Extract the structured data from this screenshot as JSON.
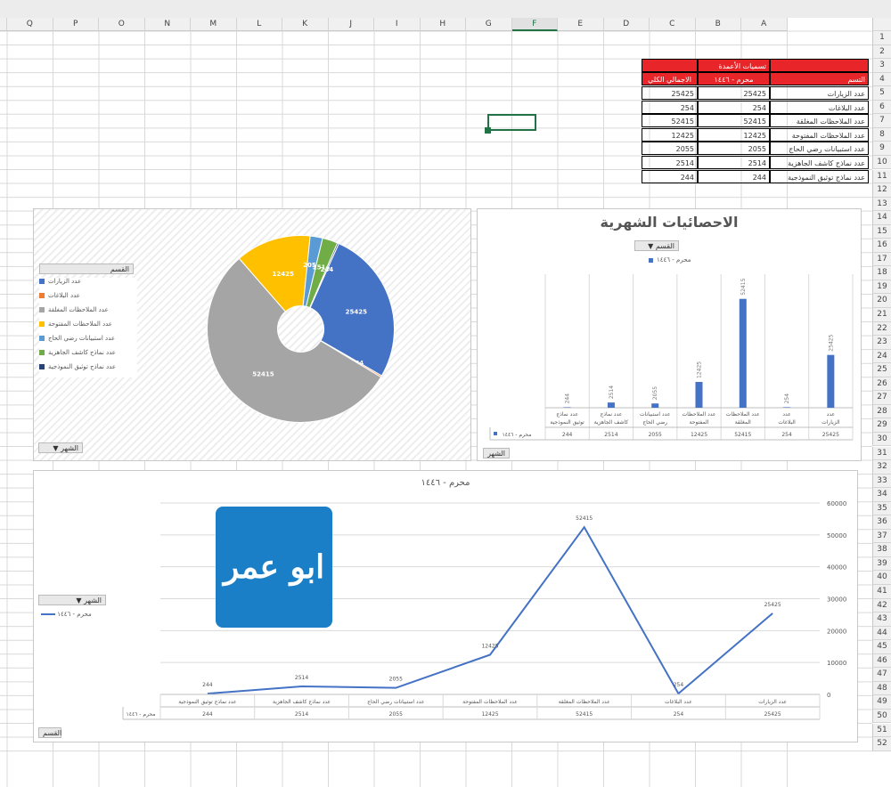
{
  "columns": [
    "Q",
    "P",
    "O",
    "N",
    "M",
    "L",
    "K",
    "J",
    "I",
    "H",
    "G",
    "F",
    "E",
    "D",
    "C",
    "B",
    "A"
  ],
  "active_column": "F",
  "rows": [
    "1",
    "2",
    "3",
    "4",
    "5",
    "6",
    "7",
    "8",
    "9",
    "10",
    "11",
    "12",
    "13",
    "14",
    "15",
    "16",
    "17",
    "18",
    "19",
    "20",
    "21",
    "22",
    "23",
    "24",
    "25",
    "26",
    "27",
    "28",
    "29",
    "30",
    "31",
    "32",
    "33",
    "34",
    "35",
    "36",
    "37",
    "38",
    "39",
    "40",
    "41",
    "42",
    "43",
    "44",
    "45",
    "46",
    "47",
    "48",
    "49",
    "50",
    "51",
    "52"
  ],
  "table": {
    "header_filter": "تسميات الأعمدة",
    "header_label_col": "التسم",
    "header_month": "محرم - ١٤٤٦",
    "header_total": "الاجمالي الكلي",
    "rows": [
      {
        "label": "عدد الزيارات",
        "month": "25425",
        "total": "25425"
      },
      {
        "label": "عدد البلاغات",
        "month": "254",
        "total": "254"
      },
      {
        "label": "عدد الملاحظات المغلقة",
        "month": "52415",
        "total": "52415"
      },
      {
        "label": "عدد الملاحظات المفتوحة",
        "month": "12425",
        "total": "12425"
      },
      {
        "label": "عدد استبيانات رضي الحاج",
        "month": "2055",
        "total": "2055"
      },
      {
        "label": "عدد نماذج كاشف الجاهزية",
        "month": "2514",
        "total": "2514"
      },
      {
        "label": "عدد نماذج توثيق النموذجية",
        "month": "244",
        "total": "244"
      }
    ]
  },
  "pie_panel": {
    "legend_title": "القسم",
    "filter_label": "الشهر",
    "legend": [
      {
        "name": "عدد الزيارات",
        "color": "#4472c4"
      },
      {
        "name": "عدد البلاغات",
        "color": "#ed7d31"
      },
      {
        "name": "عدد الملاحظات المغلقة",
        "color": "#a5a5a5"
      },
      {
        "name": "عدد الملاحظات المفتوحة",
        "color": "#ffc000"
      },
      {
        "name": "عدد استبيانات رضي الحاج",
        "color": "#5b9bd5"
      },
      {
        "name": "عدد نماذج كاشف الجاهزية",
        "color": "#70ad47"
      },
      {
        "name": "عدد نماذج توثيق النموذجية",
        "color": "#264478"
      }
    ],
    "labels": {
      "a": "25425",
      "b": "254",
      "c": "52415",
      "d": "12425",
      "e": "2055",
      "f": "2514",
      "g": "244"
    }
  },
  "bar_panel": {
    "title": "الاحصائيات الشهرية",
    "filter_label": "القسم",
    "series_label": "محرم - ١٤٤٦",
    "bottom_filter": "الشهر"
  },
  "line_panel": {
    "title": "محرم - ١٤٤٦",
    "filter_label": "الشهر",
    "series_label": "محرم - ١٤٤٦",
    "bottom_filter": "القسم"
  },
  "logo_text": "ابو عمر",
  "chart_data": [
    {
      "type": "pie",
      "categories": [
        "عدد الزيارات",
        "عدد البلاغات",
        "عدد الملاحظات المغلقة",
        "عدد الملاحظات المفتوحة",
        "عدد استبيانات رضي الحاج",
        "عدد نماذج كاشف الجاهزية",
        "عدد نماذج توثيق النموذجية"
      ],
      "values": [
        25425,
        254,
        52415,
        12425,
        2055,
        2514,
        244
      ],
      "legend_position": "left"
    },
    {
      "type": "bar",
      "title": "الاحصائيات الشهرية",
      "categories": [
        "عدد الزيارات",
        "عدد البلاغات",
        "عدد الملاحظات المغلقة",
        "عدد الملاحظات المفتوحة",
        "عدد استبيانات رضي الحاج",
        "عدد نماذج كاشف الجاهزية",
        "عدد نماذج توثيق النموذجية"
      ],
      "series": [
        {
          "name": "محرم - ١٤٤٦",
          "values": [
            25425,
            254,
            52415,
            12425,
            2055,
            2514,
            244
          ]
        }
      ],
      "data_table": true
    },
    {
      "type": "line",
      "title": "محرم - ١٤٤٦",
      "categories": [
        "عدد الزيارات",
        "عدد البلاغات",
        "عدد الملاحظات المغلقة",
        "عدد الملاحظات المفتوحة",
        "عدد استبيانات رضي الحاج",
        "عدد نماذج كاشف الجاهزية",
        "عدد نماذج توثيق النموذجية"
      ],
      "series": [
        {
          "name": "محرم - ١٤٤٦",
          "values": [
            25425,
            254,
            52415,
            12425,
            2055,
            2514,
            244
          ]
        }
      ],
      "y_ticks": [
        "0",
        "10000",
        "20000",
        "30000",
        "40000",
        "50000",
        "60000"
      ],
      "ylim": [
        0,
        60000
      ],
      "grid": true,
      "data_table": true
    }
  ]
}
